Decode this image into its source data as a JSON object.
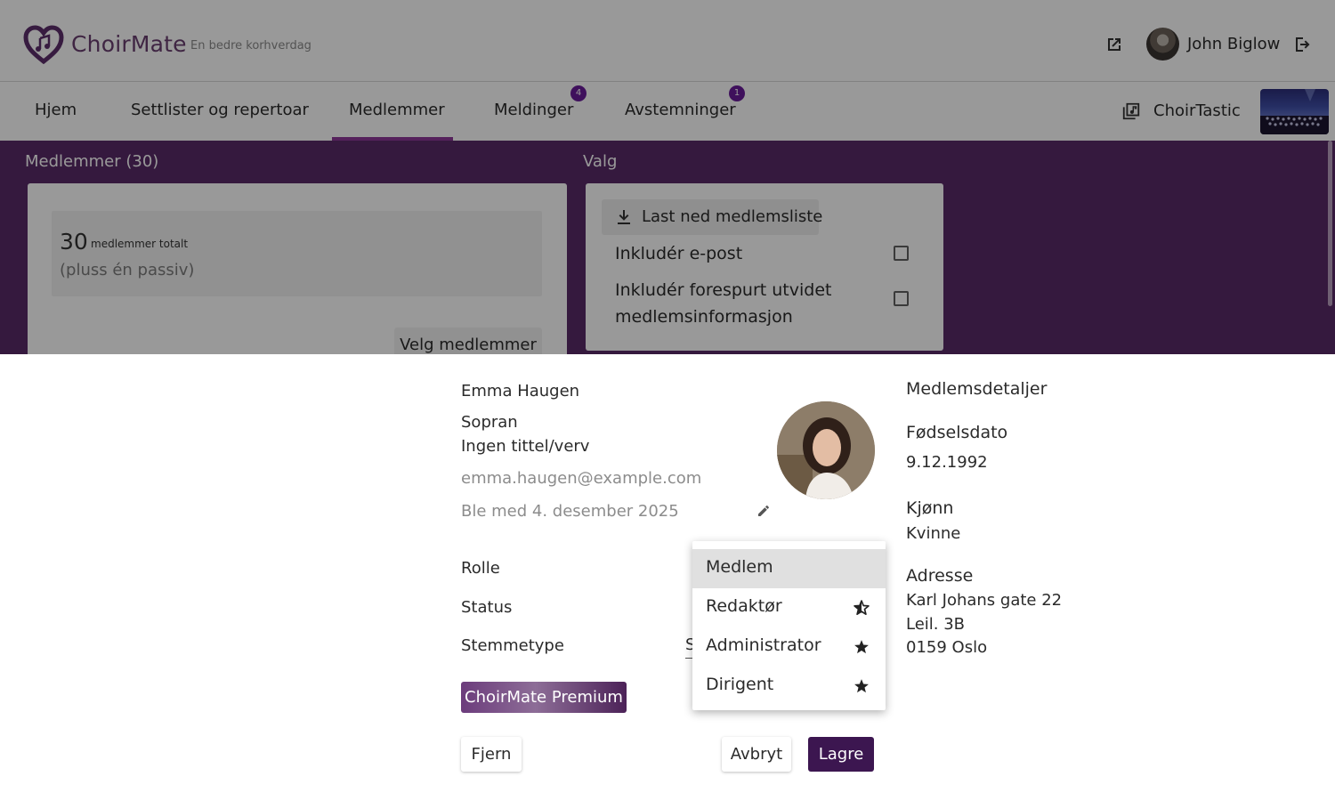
{
  "header": {
    "brand": "ChoirMate",
    "tagline": "En bedre korhverdag",
    "user_name": "John Biglow"
  },
  "nav": {
    "items": [
      "Hjem",
      "Settlister og repertoar",
      "Medlemmer",
      "Meldinger",
      "Avstemninger"
    ],
    "active": "Medlemmer",
    "badges": {
      "meldinger": "4",
      "avstemninger": "1"
    },
    "choir_name": "ChoirTastic"
  },
  "members_section": {
    "title": "Medlemmer (30)",
    "total_count": "30",
    "total_label": "medlemmer totalt",
    "passive_note": "(pluss én passiv)",
    "select_button": "Velg medlemmer"
  },
  "options_section": {
    "title": "Valg",
    "download_button": "Last ned medlemsliste",
    "include_email": "Inkludér e-post",
    "include_extended_line1": "Inkludér forespurt utvidet",
    "include_extended_line2": "medlemsinformasjon"
  },
  "member": {
    "name": "Emma Haugen",
    "voice": "Sopran",
    "title": "Ingen tittel/verv",
    "email": "emma.haugen@example.com",
    "joined": "Ble med 4. desember 2025",
    "labels": {
      "role": "Rolle",
      "status": "Status",
      "voice_type": "Stemmetype"
    },
    "voice_type_value_partial": "S",
    "premium": "ChoirMate Premium",
    "buttons": {
      "remove": "Fjern",
      "cancel": "Avbryt",
      "save": "Lagre"
    }
  },
  "role_dropdown": {
    "options": [
      "Medlem",
      "Redaktør",
      "Administrator",
      "Dirigent"
    ],
    "selected": "Medlem",
    "icons": [
      "",
      "half-star-icon",
      "star-icon",
      "star-icon"
    ]
  },
  "details": {
    "heading": "Medlemsdetaljer",
    "birth_label": "Fødselsdato",
    "birth_value": "9.12.1992",
    "gender_label": "Kjønn",
    "gender_value": "Kvinne",
    "address_label": "Adresse",
    "address_line1": "Karl Johans gate 22",
    "address_line2": "Leil. 3B",
    "address_line3": "0159 Oslo"
  },
  "colors": {
    "brand_purple": "#592a68",
    "primary_button": "#3c1650",
    "badge": "#6a1b9a",
    "active_tab": "#8e3a9a"
  }
}
